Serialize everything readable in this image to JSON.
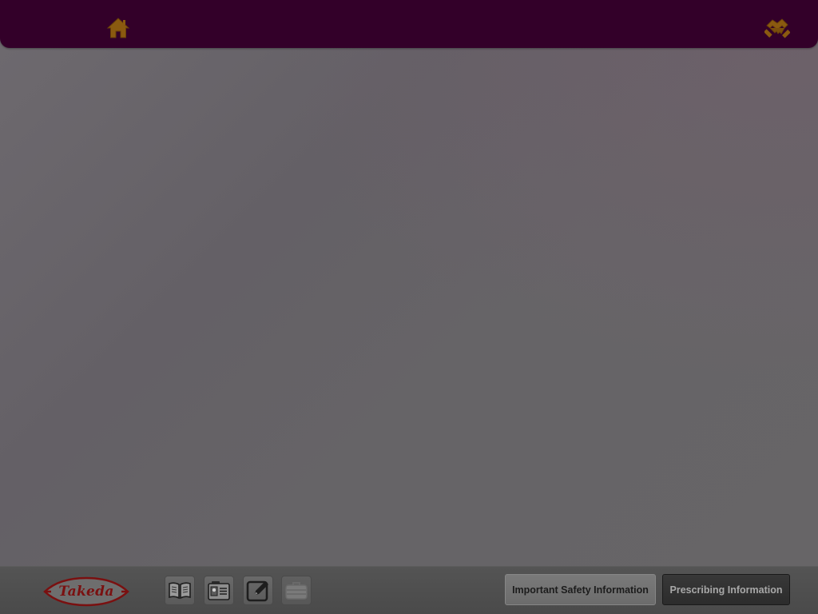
{
  "header": {
    "home_icon": "home-icon",
    "partner_icon": "handshake-icon",
    "background_color": "#330029",
    "icon_color": "#8a5a10"
  },
  "footer": {
    "logo": {
      "text": "Takeda",
      "color": "#7a1010"
    },
    "tools": [
      {
        "name": "book-icon"
      },
      {
        "name": "id-card-icon"
      },
      {
        "name": "edit-icon"
      },
      {
        "name": "briefcase-icon"
      }
    ],
    "important_safety_information_label": "Important Safety Information",
    "prescribing_information_label": "Prescribing Information"
  }
}
